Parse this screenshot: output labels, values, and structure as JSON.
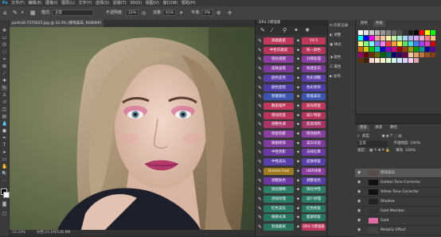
{
  "menubar": {
    "items": [
      "文件(F)",
      "编辑(E)",
      "图像(I)",
      "图层(L)",
      "文字(Y)",
      "选择(S)",
      "滤镜(T)",
      "3D(D)",
      "视图(V)",
      "窗口(W)",
      "帮助(H)"
    ]
  },
  "options": {
    "mode_label": "模式:",
    "mode_value": "正常",
    "opacity_label": "不透明度:",
    "opacity_value": "22%",
    "flow_label": "流量:",
    "flow_value": "41%",
    "smooth_label": "平滑:",
    "smooth_value": "0%"
  },
  "document": {
    "tab_label": "portrait-7375625.jpg @ 33.3% (修饰美白, RGB/8#) ×",
    "zoom": "33.33%",
    "doc_size": "文档:33.1M/136.9M"
  },
  "plugin": {
    "title": "DR4.5增强版",
    "buttons": [
      {
        "left": "高级磨皮",
        "right": "V4.5",
        "lc": "#c0395b",
        "rc": "#c0395b"
      },
      {
        "left": "中性灰磨皮",
        "right": "统一颜色",
        "lc": "#b7355a",
        "rc": "#b7355a"
      },
      {
        "left": "锐化视图",
        "right": "分频处理",
        "lc": "#8a3fa0",
        "rc": "#8a3fa0"
      },
      {
        "left": "皮肤画笔",
        "right": "快速变白",
        "lc": "#7e3b9c",
        "rc": "#7e3b9c"
      },
      {
        "left": "颜色变亮",
        "right": "色彩调整",
        "lc": "#5a3fa8",
        "rc": "#5a3fa8"
      },
      {
        "left": "颜色变暗",
        "right": "色彩修饰",
        "lc": "#4f3ca6",
        "rc": "#4f3ca6"
      },
      {
        "left": "智能锐化",
        "right": "智能美化",
        "lc": "#3c55b0",
        "rc": "#3c55b0"
      },
      {
        "left": "磨皮插件",
        "right": "高光修复",
        "lc": "#c0395b",
        "rc": "#c0395b"
      },
      {
        "left": "增加亮度",
        "right": "减少暗部",
        "lc": "#b7355a",
        "rc": "#b7355a"
      },
      {
        "left": "调整色调",
        "right": "提高饱和",
        "lc": "#a8356a",
        "rc": "#a8356a"
      },
      {
        "left": "修复瑕疵",
        "right": "修改颜色",
        "lc": "#8a3fa0",
        "rc": "#8a3fa0"
      },
      {
        "left": "眼部修饰",
        "right": "美白牙齿",
        "lc": "#7e3b9c",
        "rc": "#7e3b9c"
      },
      {
        "left": "中性阴影",
        "right": "去除红晕",
        "lc": "#6a3aa0",
        "rc": "#6a3aa0"
      },
      {
        "left": "中性高光",
        "right": "皮肤修复",
        "lc": "#5a3fa8",
        "rc": "#5a3fa8"
      },
      {
        "left": "Greens Hue",
        "right": "HDR效果",
        "lc": "#a07a20",
        "rc": "#8a3fa0"
      },
      {
        "left": "调整肤色",
        "right": "调整发色",
        "lc": "#6a3aa0",
        "rc": "#5a3fa8"
      },
      {
        "left": "锐化眼睛",
        "right": "锐化中性",
        "lc": "#2d7d68",
        "rc": "#2d7d68"
      },
      {
        "left": "添加纹理",
        "right": "减少纹理",
        "lc": "#2a7a66",
        "rc": "#2a7a66"
      },
      {
        "left": "红色美化",
        "right": "红色修复",
        "lc": "#287864",
        "rc": "#287864"
      },
      {
        "left": "眼部光泽",
        "right": "面部修复",
        "lc": "#2a7462",
        "rc": "#2a7462"
      },
      {
        "left": "智能磨皮",
        "right": "DR4.5增强版",
        "lc": "#2a7462",
        "rc": "#c0395b"
      }
    ]
  },
  "midpanel": {
    "items": [
      "历史记录",
      "调整",
      "样式",
      "颜色",
      "属性",
      "动作"
    ]
  },
  "swatches": {
    "tabs": [
      "颜色",
      "色板"
    ],
    "colors": [
      "#ffffff",
      "#e6e6e6",
      "#cccccc",
      "#b3b3b3",
      "#999999",
      "#808080",
      "#666666",
      "#4d4d4d",
      "#333333",
      "#1a1a1a",
      "#000000",
      "#ff0000",
      "#ffff00",
      "#00ff00",
      "#00ffff",
      "#0000ff",
      "#ff00ff",
      "#f4a6a6",
      "#f6c8a0",
      "#f9f3a6",
      "#c6f0a6",
      "#a6f0d0",
      "#a6d8f4",
      "#b0b8f4",
      "#d4a6f4",
      "#f4a6d8",
      "#ff8080",
      "#ffbf80",
      "#ffff80",
      "#80ff80",
      "#80ffff",
      "#8080ff",
      "#ff80ff",
      "#ff4040",
      "#ff9a40",
      "#ffee40",
      "#60e060",
      "#40e0e0",
      "#4080ff",
      "#a040ff",
      "#e040c0",
      "#cc0000",
      "#cc6600",
      "#cccc00",
      "#00cc00",
      "#00cccc",
      "#0000cc",
      "#8800cc",
      "#cc0088",
      "#990000",
      "#994400",
      "#999900",
      "#009900",
      "#009999",
      "#000099",
      "#550099",
      "#990066",
      "#660000",
      "#663300",
      "#666600",
      "#006600",
      "#006666",
      "#000066",
      "#330066",
      "#660044",
      "#f0c8a0",
      "#e0a070",
      "#c07840",
      "#a05020",
      "#804010",
      "#603010",
      "#402008",
      "#ffd0d0",
      "#ffe8d0",
      "#fff8d0",
      "#e0ffd0",
      "#d0fff0",
      "#d0e8ff",
      "#e0d0ff",
      "#ffd0f0",
      "#d8a8a8"
    ]
  },
  "layers_panel": {
    "tabs": [
      "图层",
      "通道",
      "路径"
    ],
    "kind_label": "类型",
    "blend": "正常",
    "opacity_label": "不透明度:",
    "opacity": "100%",
    "lock_label": "锁定:",
    "fill_label": "填充:",
    "fill": "100%",
    "layers": [
      {
        "name": "修饰美白",
        "thumb": "#5a4a45",
        "selected": true
      },
      {
        "name": "Golden Tone Corrector",
        "thumb": "#111111",
        "selected": false
      },
      {
        "name": "Yellow Tone Corrector",
        "thumb": "#111111",
        "selected": false
      },
      {
        "name": "Shadow",
        "thumb": "#222222",
        "selected": false
      },
      {
        "name": "Gold Member",
        "thumb": "#333333",
        "selected": false
      },
      {
        "name": "Gold",
        "thumb": "#e06aa6",
        "selected": false
      },
      {
        "name": "Metallic Effect",
        "thumb": "#444444",
        "selected": false
      }
    ]
  },
  "colors": {
    "accent": "#c0395b",
    "panel": "#3a3a3a",
    "canvas_bg": "#6b7654"
  }
}
